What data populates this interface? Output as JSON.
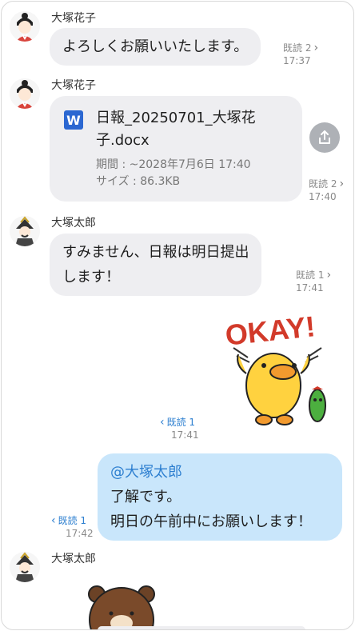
{
  "messages": [
    {
      "sender": "大塚花子",
      "text": "よろしくお願いいたします。",
      "read": "既読 2",
      "time": "17:37"
    },
    {
      "sender": "大塚花子",
      "file": {
        "icon": "W",
        "name_line1": "日報_20250701_大塚花",
        "name_line2": "子.docx",
        "period": "期間 : ~2028年7月6日 17:40",
        "size": "サイズ : 86.3KB"
      },
      "read": "既読 2",
      "time": "17:40"
    },
    {
      "sender": "大塚太郎",
      "text_line1": "すみません、日報は明日提出",
      "text_line2": "します！",
      "read": "既読 1",
      "time": "17:41"
    },
    {
      "sticker": "OKAY!",
      "read": "既読 1",
      "time": "17:41"
    },
    {
      "mention": "@大塚太郎",
      "line1": "了解です。",
      "line2": "明日の午前中にお願いします！",
      "read": "既読 1",
      "time": "17:42"
    },
    {
      "sender": "大塚太郎"
    }
  ],
  "colors": {
    "received_bubble": "#eeeef1",
    "sent_bubble": "#c9e6fb",
    "read_blue": "#2d7fd0",
    "word_icon": "#2b67d1"
  }
}
